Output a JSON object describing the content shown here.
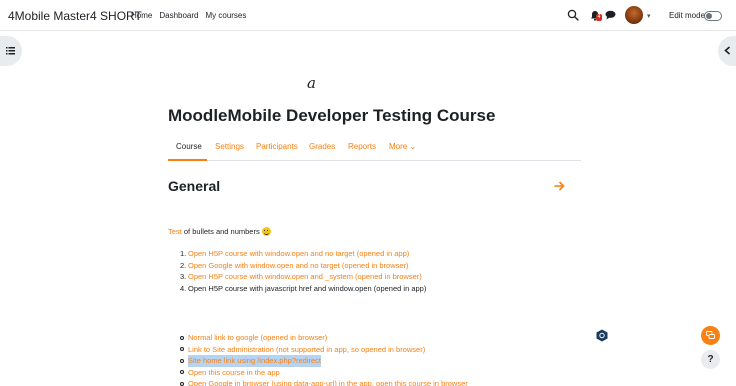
{
  "header": {
    "site_name": "4Mobile Master4 SHORT",
    "nav": [
      "Home",
      "Dashboard",
      "My courses"
    ],
    "notification_count": "4",
    "edit_mode_label": "Edit mode",
    "edit_mode_on": false
  },
  "course": {
    "logo_text": "a",
    "title": "MoodleMobile Developer Testing Course",
    "tabs": [
      {
        "label": "Course",
        "active": true
      },
      {
        "label": "Settings",
        "active": false
      },
      {
        "label": "Participants",
        "active": false
      },
      {
        "label": "Grades",
        "active": false
      },
      {
        "label": "Reports",
        "active": false
      },
      {
        "label": "More",
        "active": false
      }
    ]
  },
  "section": {
    "title": "General",
    "intro_link": "Test",
    "intro_text": " of bullets and numbers",
    "ordered_items": [
      {
        "n": "1.",
        "text": "Open H5P course with window.open and no target (opened in app)",
        "link": true
      },
      {
        "n": "2.",
        "text": "Open Google with window.open and no target (opened in browser)",
        "link": true
      },
      {
        "n": "3.",
        "text": "Open H5P course with window.open and _system (opened in browser)",
        "link": true
      },
      {
        "n": "4.",
        "text": "Open H5P course with javascript href and window.open (opened in app)",
        "link": false
      }
    ],
    "bullet_items": [
      {
        "text": "Normal link to google (opened in browser)",
        "highlighted": false
      },
      {
        "text": "Link to Site administration (not supported in app, so opened in browser)",
        "highlighted": false
      },
      {
        "text": "Site home link using /index.php?redirect",
        "highlighted": true
      },
      {
        "text": "Open this course in the app",
        "highlighted": false
      },
      {
        "text": "Open Google in browser (using data-app-url) in the app, open this course in browser",
        "highlighted": false
      }
    ]
  },
  "floating": {
    "help_label": "?"
  },
  "colors": {
    "accent": "#f98012",
    "text": "#1d2125",
    "badge": "#ca3120"
  }
}
